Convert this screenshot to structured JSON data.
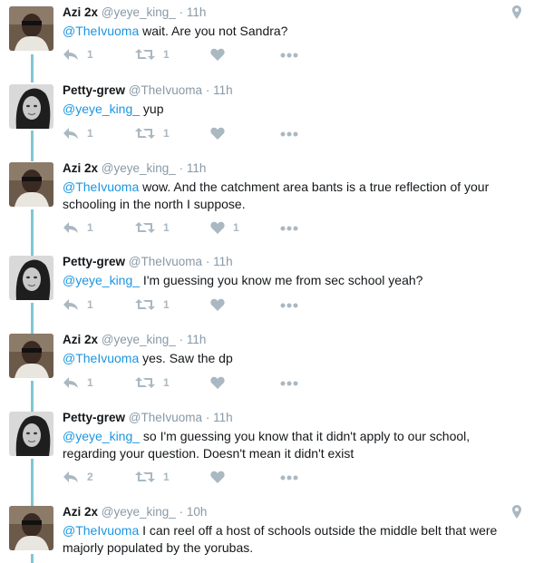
{
  "tweets": [
    {
      "name": "Azi 2x",
      "handle": "@yeye_king_",
      "time": "11h",
      "mention": "@TheIvuoma",
      "text": " wait. Are you not Sandra?",
      "reply_count": "1",
      "retweet_count": "1",
      "like_count": "",
      "avatar": "man-avatar",
      "location_icon": true
    },
    {
      "name": "Petty-grew",
      "handle": "@TheIvuoma",
      "time": "11h",
      "mention": "@yeye_king_",
      "text": " yup",
      "reply_count": "1",
      "retweet_count": "1",
      "like_count": "",
      "avatar": "woman-avatar",
      "location_icon": false
    },
    {
      "name": "Azi 2x",
      "handle": "@yeye_king_",
      "time": "11h",
      "mention": "@TheIvuoma",
      "text": " wow. And the catchment area bants is a true reflection of your schooling in the north I suppose.",
      "reply_count": "1",
      "retweet_count": "1",
      "like_count": "1",
      "avatar": "man-avatar",
      "location_icon": false
    },
    {
      "name": "Petty-grew",
      "handle": "@TheIvuoma",
      "time": "11h",
      "mention": "@yeye_king_",
      "text": " I'm guessing you know me from sec school yeah?",
      "reply_count": "1",
      "retweet_count": "1",
      "like_count": "",
      "avatar": "woman-avatar",
      "location_icon": false
    },
    {
      "name": "Azi 2x",
      "handle": "@yeye_king_",
      "time": "11h",
      "mention": "@TheIvuoma",
      "text": " yes. Saw the dp",
      "reply_count": "1",
      "retweet_count": "1",
      "like_count": "",
      "avatar": "man-avatar",
      "location_icon": false
    },
    {
      "name": "Petty-grew",
      "handle": "@TheIvuoma",
      "time": "11h",
      "mention": "@yeye_king_",
      "text": " so I'm guessing you know that it didn't apply to our school, regarding your question. Doesn't mean it didn't exist",
      "reply_count": "2",
      "retweet_count": "1",
      "like_count": "",
      "avatar": "woman-avatar",
      "location_icon": false
    },
    {
      "name": "Azi 2x",
      "handle": "@yeye_king_",
      "time": "10h",
      "mention": "@TheIvuoma",
      "text": " I can reel off a host of schools outside the middle belt that were majorly populated by the yorubas.",
      "reply_count": "",
      "retweet_count": "",
      "like_count": "",
      "avatar": "man-avatar",
      "location_icon": true
    }
  ],
  "separator": "·",
  "colors": {
    "mention": "#1b95e0",
    "thread": "#80c6d4",
    "muted": "#8899a6",
    "icon": "#aab8c2"
  }
}
